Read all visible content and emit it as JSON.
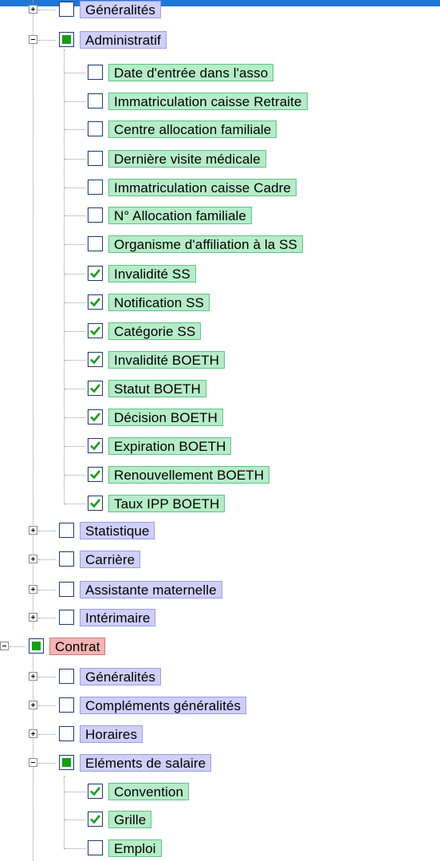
{
  "tree": {
    "nodes": [
      {
        "key": "generalites",
        "label": "Généralités",
        "state": "unchecked",
        "style": "blue",
        "expander": "plus",
        "level": 1
      },
      {
        "key": "administratif",
        "label": "Administratif",
        "state": "partial",
        "style": "blue",
        "expander": "minus",
        "level": 1
      },
      {
        "key": "date-entree",
        "label": "Date d'entrée dans l'asso",
        "state": "unchecked",
        "style": "green",
        "level": 2
      },
      {
        "key": "immat-retraite",
        "label": "Immatriculation caisse Retraite",
        "state": "unchecked",
        "style": "green",
        "level": 2
      },
      {
        "key": "centre-alloc",
        "label": "Centre allocation familiale",
        "state": "unchecked",
        "style": "green",
        "level": 2
      },
      {
        "key": "derniere-visite",
        "label": "Dernière visite médicale",
        "state": "unchecked",
        "style": "green",
        "level": 2
      },
      {
        "key": "immat-cadre",
        "label": "Immatriculation caisse Cadre",
        "state": "unchecked",
        "style": "green",
        "level": 2
      },
      {
        "key": "num-alloc",
        "label": "N° Allocation familiale",
        "state": "unchecked",
        "style": "green",
        "level": 2
      },
      {
        "key": "organisme-ss",
        "label": "Organisme d'affiliation à la SS",
        "state": "unchecked",
        "style": "green",
        "level": 2
      },
      {
        "key": "invalidite-ss",
        "label": "Invalidité SS",
        "state": "checked",
        "style": "green",
        "level": 2
      },
      {
        "key": "notification-ss",
        "label": "Notification SS",
        "state": "checked",
        "style": "green",
        "level": 2
      },
      {
        "key": "categorie-ss",
        "label": "Catégorie SS",
        "state": "checked",
        "style": "green",
        "level": 2
      },
      {
        "key": "invalidite-boeth",
        "label": "Invalidité BOETH",
        "state": "checked",
        "style": "green",
        "level": 2
      },
      {
        "key": "statut-boeth",
        "label": "Statut BOETH",
        "state": "checked",
        "style": "green",
        "level": 2
      },
      {
        "key": "decision-boeth",
        "label": "Décision BOETH",
        "state": "checked",
        "style": "green",
        "level": 2
      },
      {
        "key": "expiration-boeth",
        "label": "Expiration BOETH",
        "state": "checked",
        "style": "green",
        "level": 2
      },
      {
        "key": "renouvellement-boeth",
        "label": "Renouvellement BOETH",
        "state": "checked",
        "style": "green",
        "level": 2
      },
      {
        "key": "taux-ipp-boeth",
        "label": "Taux IPP BOETH",
        "state": "checked",
        "style": "green",
        "level": 2
      },
      {
        "key": "statistique",
        "label": "Statistique",
        "state": "unchecked",
        "style": "blue",
        "expander": "plus",
        "level": 1
      },
      {
        "key": "carriere",
        "label": "Carrière",
        "state": "unchecked",
        "style": "blue",
        "expander": "plus",
        "level": 1
      },
      {
        "key": "assistante-maternelle",
        "label": "Assistante maternelle",
        "state": "unchecked",
        "style": "blue",
        "expander": "plus",
        "level": 1
      },
      {
        "key": "interimaire",
        "label": "Intérimaire",
        "state": "unchecked",
        "style": "blue",
        "expander": "plus",
        "level": 1
      },
      {
        "key": "contrat",
        "label": "Contrat",
        "state": "partial",
        "style": "red",
        "expander": "minus",
        "level": 0
      },
      {
        "key": "contrat-generalites",
        "label": "Généralités",
        "state": "unchecked",
        "style": "blue",
        "expander": "plus",
        "level": 1
      },
      {
        "key": "complements-generalites",
        "label": "Compléments généralités",
        "state": "unchecked",
        "style": "blue",
        "expander": "plus",
        "level": 1
      },
      {
        "key": "horaires",
        "label": "Horaires",
        "state": "unchecked",
        "style": "blue",
        "expander": "plus",
        "level": 1
      },
      {
        "key": "elements-salaire",
        "label": "Eléments de salaire",
        "state": "partial",
        "style": "blue",
        "expander": "minus",
        "level": 1
      },
      {
        "key": "convention",
        "label": "Convention",
        "state": "checked",
        "style": "green",
        "level": 2
      },
      {
        "key": "grille",
        "label": "Grille",
        "state": "checked",
        "style": "green",
        "level": 2
      },
      {
        "key": "emploi",
        "label": "Emploi",
        "state": "unchecked",
        "style": "green",
        "level": 2
      }
    ]
  },
  "colors": {
    "accent_bar": "#1e78d8",
    "group_label_bg": "#cfcffa",
    "field_label_bg": "#b6ecc8",
    "root_label_bg": "#f3b4b4",
    "partial_fill": "#12a012",
    "check_mark": "#12a012"
  }
}
